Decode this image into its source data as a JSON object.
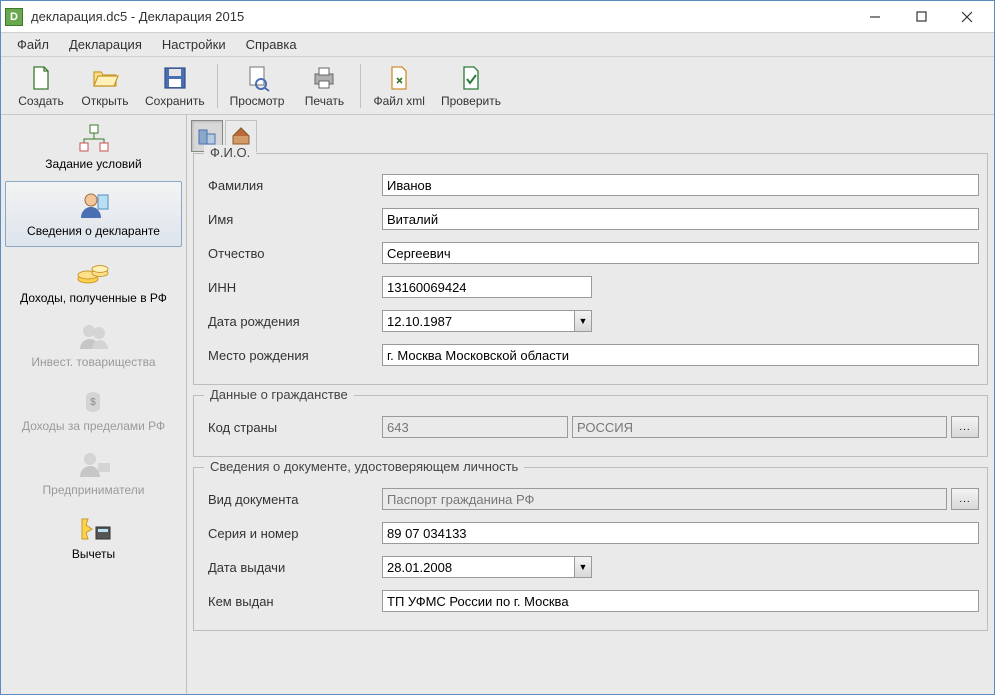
{
  "window": {
    "title": "декларация.dc5 - Декларация 2015",
    "app_icon_letter": "D"
  },
  "menubar": {
    "file": "Файл",
    "declaration": "Декларация",
    "settings": "Настройки",
    "help": "Справка"
  },
  "toolbar": {
    "create": "Создать",
    "open": "Открыть",
    "save": "Сохранить",
    "preview": "Просмотр",
    "print": "Печать",
    "filexml": "Файл xml",
    "check": "Проверить"
  },
  "sidebar": {
    "conditions": "Задание условий",
    "declarant": "Сведения о декларанте",
    "income_rf": "Доходы, полученные в РФ",
    "invest": "Инвест. товарищества",
    "income_abroad": "Доходы за пределами РФ",
    "business": "Предприниматели",
    "deductions": "Вычеты"
  },
  "sections": {
    "fio": {
      "legend": "Ф.И.О.",
      "surname_label": "Фамилия",
      "surname": "Иванов",
      "name_label": "Имя",
      "name": "Виталий",
      "patronymic_label": "Отчество",
      "patronymic": "Сергеевич",
      "inn_label": "ИНН",
      "inn": "13160069424",
      "dob_label": "Дата рождения",
      "dob": "12.10.1987",
      "pob_label": "Место рождения",
      "pob": "г. Москва Московской области"
    },
    "citizenship": {
      "legend": "Данные о гражданстве",
      "code_label": "Код страны",
      "code": "643",
      "country": "РОССИЯ",
      "lookup": "..."
    },
    "identity": {
      "legend": "Сведения о документе, удостоверяющем личность",
      "type_label": "Вид документа",
      "type": "Паспорт гражданина РФ",
      "serial_label": "Серия и номер",
      "serial": "89 07 034133",
      "issue_date_label": "Дата выдачи",
      "issue_date": "28.01.2008",
      "issued_by_label": "Кем выдан",
      "issued_by": "ТП УФМС России по г. Москва",
      "lookup": "..."
    }
  }
}
